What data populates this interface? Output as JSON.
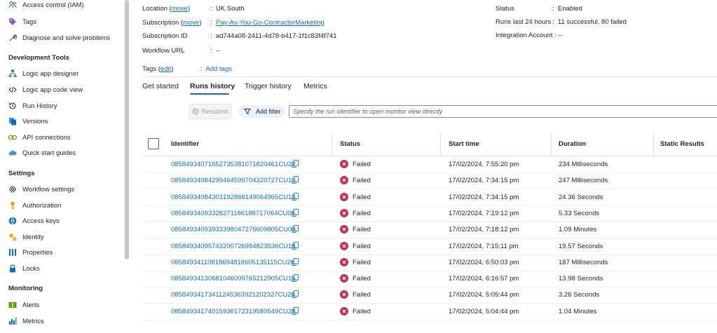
{
  "sidebar": {
    "items": [
      {
        "label": "Access control (IAM)",
        "icon": "people-icon"
      },
      {
        "label": "Tags",
        "icon": "tag-icon"
      },
      {
        "label": "Diagnose and solve problems",
        "icon": "wrench-icon"
      }
    ],
    "sections": [
      {
        "title": "Development Tools",
        "items": [
          {
            "label": "Logic app designer",
            "icon": "designer-icon"
          },
          {
            "label": "Logic app code view",
            "icon": "code-icon"
          },
          {
            "label": "Run History",
            "icon": "history-icon"
          },
          {
            "label": "Versions",
            "icon": "versions-icon"
          },
          {
            "label": "API connections",
            "icon": "api-connection-icon"
          },
          {
            "label": "Quick start guides",
            "icon": "cloud-icon"
          }
        ]
      },
      {
        "title": "Settings",
        "items": [
          {
            "label": "Workflow settings",
            "icon": "gear-icon"
          },
          {
            "label": "Authorization",
            "icon": "key-icon"
          },
          {
            "label": "Access keys",
            "icon": "globe-icon"
          },
          {
            "label": "Identity",
            "icon": "identity-icon"
          },
          {
            "label": "Properties",
            "icon": "properties-icon"
          },
          {
            "label": "Locks",
            "icon": "lock-icon"
          }
        ]
      },
      {
        "title": "Monitoring",
        "items": [
          {
            "label": "Alerts",
            "icon": "alerts-icon"
          },
          {
            "label": "Metrics",
            "icon": "metrics-icon"
          }
        ]
      }
    ]
  },
  "essentials": {
    "location": {
      "label": "Location",
      "action": "move",
      "value": "UK South"
    },
    "subscription": {
      "label": "Subscription",
      "action": "move",
      "value": "Pay-As-You-Go-ContractorMarketing"
    },
    "subscription_id": {
      "label": "Subscription ID",
      "value": "ad744a08-2411-4d78-b417-1f1c83f4f741"
    },
    "workflow_url": {
      "label": "Workflow URL",
      "value": "--"
    },
    "status": {
      "label": "Status",
      "value": "Enabled"
    },
    "runs_24h": {
      "label": "Runs last 24 hours",
      "value": "11 successful, 80 failed"
    },
    "integration_account": {
      "label": "Integration Account",
      "value": "--"
    },
    "separator": ":",
    "tags": {
      "label": "Tags",
      "action": "edit",
      "value": "Add tags"
    }
  },
  "tabs": [
    {
      "label": "Get started",
      "active": false
    },
    {
      "label": "Runs history",
      "active": true
    },
    {
      "label": "Trigger history",
      "active": false
    },
    {
      "label": "Metrics",
      "active": false
    }
  ],
  "toolbar": {
    "resubmit_label": "Resubmit",
    "filter_label": "Add filter",
    "search_placeholder": "Specify the run identifier to open monitor view directly"
  },
  "table": {
    "columns": [
      "Identifier",
      "Status",
      "Start time",
      "Duration",
      "Static Results"
    ],
    "rows": [
      {
        "id": "08584934071652735381071820461CU22",
        "status": "Failed",
        "start": "17/02/2024, 7:55:20 pm",
        "duration": "234 Milliseconds"
      },
      {
        "id": "08584934084299464599704320727CU10",
        "status": "Failed",
        "start": "17/02/2024, 7:34:15 pm",
        "duration": "247 Milliseconds"
      },
      {
        "id": "08584934084303192868149064965CU13",
        "status": "Failed",
        "start": "17/02/2024, 7:34:15 pm",
        "duration": "24.36 Seconds"
      },
      {
        "id": "08584934093328271186188717064CU08",
        "status": "Failed",
        "start": "17/02/2024, 7:19:12 pm",
        "duration": "5.33 Seconds"
      },
      {
        "id": "08584934093933398047276609805CU09",
        "status": "Failed",
        "start": "17/02/2024, 7:18:12 pm",
        "duration": "1.09 Minutes"
      },
      {
        "id": "08584934095743200726984823536CU18",
        "status": "Failed",
        "start": "17/02/2024, 7:15:11 pm",
        "duration": "19.57 Seconds"
      },
      {
        "id": "08584934110818694818605135115CU26",
        "status": "Failed",
        "start": "17/02/2024, 6:50:03 pm",
        "duration": "187 Milliseconds"
      },
      {
        "id": "08584934130681046009765212905CU15",
        "status": "Failed",
        "start": "17/02/2024, 6:16:57 pm",
        "duration": "13.98 Seconds"
      },
      {
        "id": "08584934173411245363921202327CU28",
        "status": "Failed",
        "start": "17/02/2024, 5:05:44 pm",
        "duration": "3.26 Seconds"
      },
      {
        "id": "08584934174015936172319580549CU28",
        "status": "Failed",
        "start": "17/02/2024, 5:04:44 pm",
        "duration": "1.04 Minutes"
      }
    ]
  },
  "colors": {
    "accent": "#0f6cbd",
    "failed": "#c4314b"
  }
}
